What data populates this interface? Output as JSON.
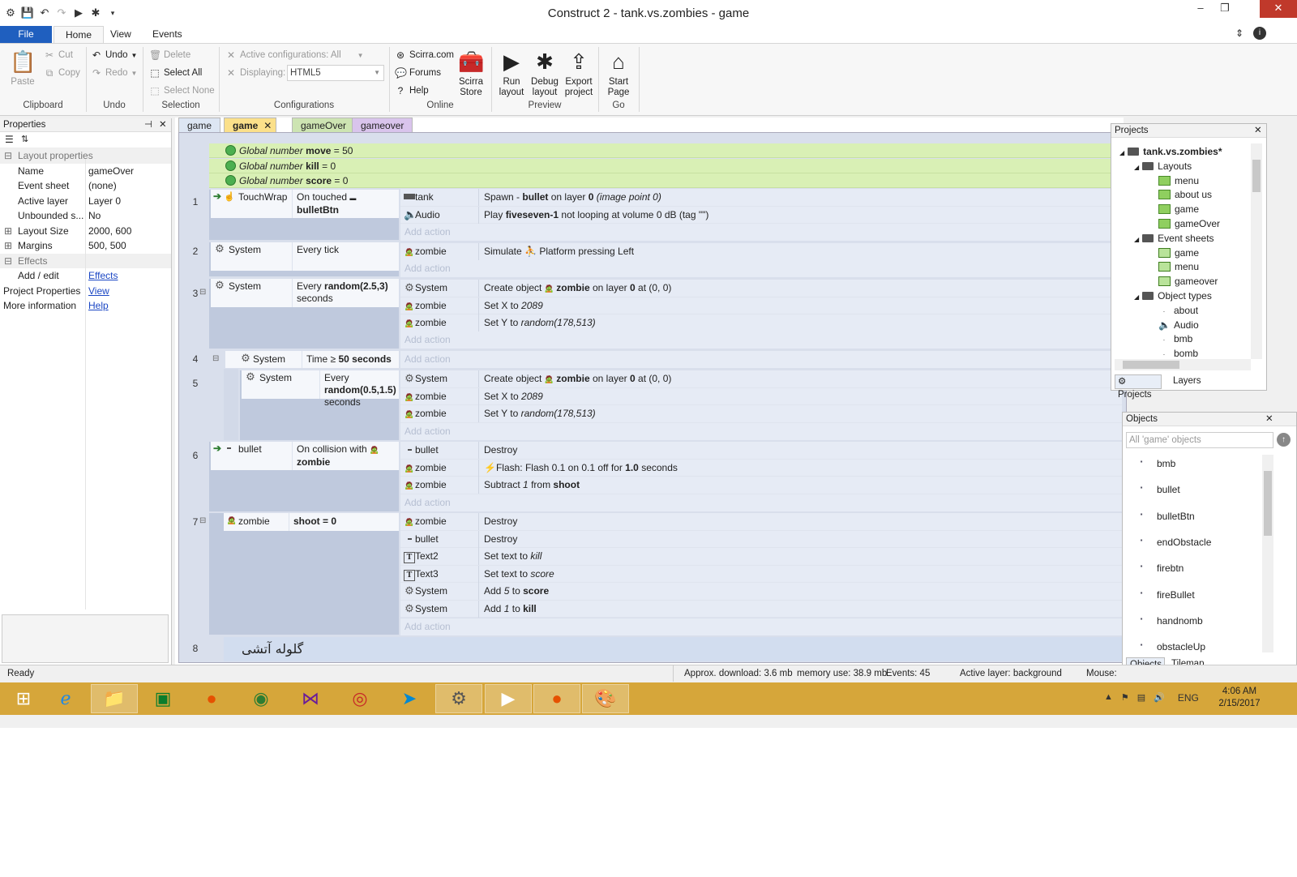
{
  "window": {
    "title": "Construct 2 - tank.vs.zombies - game"
  },
  "ribbon_tabs": [
    "File",
    "Home",
    "View",
    "Events"
  ],
  "ribbon": {
    "clipboard": {
      "paste": "Paste",
      "cut": "Cut",
      "copy": "Copy",
      "label": "Clipboard"
    },
    "undo": {
      "undo": "Undo",
      "redo": "Redo",
      "label": "Undo"
    },
    "selection": {
      "delete": "Delete",
      "select_all": "Select All",
      "select_none": "Select None",
      "label": "Selection"
    },
    "configurations": {
      "active": "Active configurations: All",
      "displaying": "Displaying:",
      "displaying_value": "HTML5",
      "label": "Configurations"
    },
    "online": {
      "scirra": "Scirra.com",
      "forums": "Forums",
      "help": "Help",
      "store": "Scirra Store",
      "label": "Online"
    },
    "preview": {
      "run": "Run layout",
      "debug": "Debug layout",
      "export": "Export project",
      "label": "Preview"
    },
    "go": {
      "start": "Start Page",
      "label": "Go"
    }
  },
  "properties": {
    "title": "Properties",
    "section_layout": "Layout properties",
    "rows": [
      {
        "k": "Name",
        "v": "gameOver"
      },
      {
        "k": "Event sheet",
        "v": "(none)"
      },
      {
        "k": "Active layer",
        "v": "Layer 0"
      },
      {
        "k": "Unbounded s...",
        "v": "No"
      },
      {
        "k": "Layout Size",
        "v": "2000, 600"
      },
      {
        "k": "Margins",
        "v": "500, 500"
      }
    ],
    "section_effects": "Effects",
    "add_edit": "Add / edit",
    "effects_link": "Effects",
    "project_props": "Project Properties",
    "view_link": "View",
    "more_info": "More information",
    "help_link": "Help"
  },
  "editor_tabs": [
    "game",
    "game",
    "gameOver",
    "gameover"
  ],
  "globals": [
    {
      "name": "move",
      "value": "50"
    },
    {
      "name": "kill",
      "value": "0"
    },
    {
      "name": "score",
      "value": "0"
    }
  ],
  "global_prefix": "Global number",
  "events": {
    "e1": {
      "num": "1",
      "obj": "TouchWrap",
      "cond": "On touched",
      "cond_b": "bulletBtn",
      "actions": [
        {
          "o": "tank",
          "d": "Spawn",
          "d2": "bullet",
          "d3": "on layer",
          "d4": "0",
          "d5": "(image point 0)"
        },
        {
          "o": "Audio",
          "d": "Play",
          "d2": "fiveseven-1",
          "d3": "not looping at volume 0 dB (tag \"\")"
        }
      ]
    },
    "e2": {
      "num": "2",
      "obj": "System",
      "cond": "Every tick",
      "actions": [
        {
          "o": "zombie",
          "d": "Simulate",
          "d2": "Platform pressing Left"
        }
      ]
    },
    "e3": {
      "num": "3",
      "obj": "System",
      "cond": "Every",
      "cond_b": "random(2.5,3)",
      "cond_c": "seconds",
      "actions": [
        {
          "o": "System",
          "d": "Create object",
          "d2": "zombie",
          "d3": "on layer",
          "d4": "0",
          "d5": "at (0, 0)"
        },
        {
          "o": "zombie",
          "d": "Set X to",
          "d2": "2089"
        },
        {
          "o": "zombie",
          "d": "Set Y to",
          "d2": "random(178,513)"
        }
      ]
    },
    "e4": {
      "num": "4",
      "obj": "System",
      "cond": "Time ≥",
      "cond_b": "50 seconds"
    },
    "e5": {
      "num": "5",
      "obj": "System",
      "cond": "Every",
      "cond_b": "random(0.5,1.5)",
      "cond_c": "seconds",
      "actions": [
        {
          "o": "System",
          "d": "Create object",
          "d2": "zombie",
          "d3": "on layer",
          "d4": "0",
          "d5": "at (0, 0)"
        },
        {
          "o": "zombie",
          "d": "Set X to",
          "d2": "2089"
        },
        {
          "o": "zombie",
          "d": "Set Y to",
          "d2": "random(178,513)"
        }
      ]
    },
    "e6": {
      "num": "6",
      "obj": "bullet",
      "cond": "On collision with",
      "cond_b": "zombie",
      "actions": [
        {
          "o": "bullet",
          "d": "Destroy"
        },
        {
          "o": "zombie",
          "d": "Flash: Flash 0.1 on 0.1 off for",
          "d2": "1.0",
          "d3": "seconds"
        },
        {
          "o": "zombie",
          "d": "Subtract",
          "d2": "1",
          "d3": "from",
          "d4": "shoot"
        }
      ]
    },
    "e7": {
      "num": "7",
      "obj": "zombie",
      "cond": "shoot = 0",
      "actions": [
        {
          "o": "zombie",
          "d": "Destroy"
        },
        {
          "o": "bullet",
          "d": "Destroy"
        },
        {
          "o": "Text2",
          "d": "Set text to",
          "d2": "kill"
        },
        {
          "o": "Text3",
          "d": "Set text to",
          "d2": "score"
        },
        {
          "o": "System",
          "d": "Add",
          "d2": "5",
          "d3": "to",
          "d4": "score"
        },
        {
          "o": "System",
          "d": "Add",
          "d2": "1",
          "d3": "to",
          "d4": "kill"
        }
      ]
    },
    "e8": {
      "num": "8",
      "comment": "گلوله آتشی"
    }
  },
  "add_action": "Add action",
  "projects": {
    "title": "Projects",
    "root": "tank.vs.zombies*",
    "layouts_label": "Layouts",
    "layouts": [
      "menu",
      "about us",
      "game",
      "gameOver"
    ],
    "sheets_label": "Event sheets",
    "sheets": [
      "game",
      "menu",
      "gameover"
    ],
    "types_label": "Object types",
    "types": [
      "about",
      "Audio",
      "bmb",
      "bomb"
    ],
    "tab_projects": "Projects",
    "tab_layers": "Layers"
  },
  "objects": {
    "title": "Objects",
    "filter": "All 'game' objects",
    "items": [
      "bmb",
      "bullet",
      "bulletBtn",
      "endObstacle",
      "firebtn",
      "fireBullet",
      "handnomb",
      "obstacleUp"
    ],
    "tab_objects": "Objects",
    "tab_tilemap": "Tilemap"
  },
  "status": {
    "ready": "Ready",
    "download": "Approx. download: 3.6 mb",
    "memory": "memory use: 38.9 mb",
    "events": "Events: 45",
    "layer": "Active layer: background",
    "mouse": "Mouse:"
  },
  "taskbar": {
    "lang": "ENG",
    "time": "4:06 AM",
    "date": "2/15/2017"
  }
}
